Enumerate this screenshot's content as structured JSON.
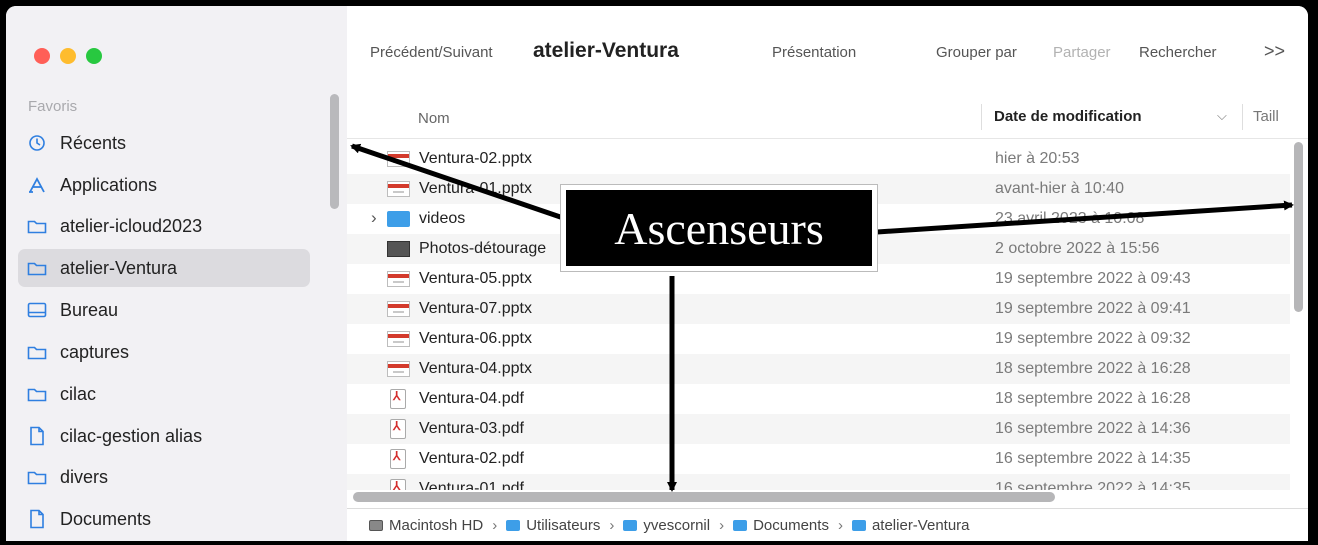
{
  "sidebar": {
    "section_title": "Favoris",
    "items": [
      {
        "label": "Récents",
        "icon": "clock-icon"
      },
      {
        "label": "Applications",
        "icon": "applications-icon"
      },
      {
        "label": "atelier-icloud2023",
        "icon": "folder-icon"
      },
      {
        "label": "atelier-Ventura",
        "icon": "folder-icon"
      },
      {
        "label": "Bureau",
        "icon": "desktop-icon"
      },
      {
        "label": "captures",
        "icon": "folder-icon"
      },
      {
        "label": "cilac",
        "icon": "folder-icon"
      },
      {
        "label": "cilac-gestion alias",
        "icon": "document-icon"
      },
      {
        "label": "divers",
        "icon": "folder-icon"
      },
      {
        "label": "Documents",
        "icon": "document-icon"
      }
    ]
  },
  "toolbar": {
    "nav_label": "Précédent/Suivant",
    "title": "atelier-Ventura",
    "view_label": "Présentation",
    "group_label": "Grouper par",
    "share_label": "Partager",
    "search_label": "Rechercher",
    "more_label": ">>"
  },
  "columns": {
    "name": "Nom",
    "date": "Date de modification",
    "size": "Taill"
  },
  "files": [
    {
      "name": "Ventura-02.pptx",
      "date": "hier à 20:53",
      "type": "pptx"
    },
    {
      "name": "Ventura-01.pptx",
      "date": "avant-hier à 10:40",
      "type": "pptx"
    },
    {
      "name": "videos",
      "date": "23 avril 2023 à 10:08",
      "type": "folder"
    },
    {
      "name": "Photos-détourage",
      "date": "2 octobre 2022 à 15:56",
      "type": "photo"
    },
    {
      "name": "Ventura-05.pptx",
      "date": "19 septembre 2022 à 09:43",
      "type": "pptx"
    },
    {
      "name": "Ventura-07.pptx",
      "date": "19 septembre 2022 à 09:41",
      "type": "pptx"
    },
    {
      "name": "Ventura-06.pptx",
      "date": "19 septembre 2022 à 09:32",
      "type": "pptx"
    },
    {
      "name": "Ventura-04.pptx",
      "date": "18 septembre 2022 à 16:28",
      "type": "pptx"
    },
    {
      "name": "Ventura-04.pdf",
      "date": "18 septembre 2022 à 16:28",
      "type": "pdf"
    },
    {
      "name": "Ventura-03.pdf",
      "date": "16 septembre 2022 à 14:36",
      "type": "pdf"
    },
    {
      "name": "Ventura-02.pdf",
      "date": "16 septembre 2022 à 14:35",
      "type": "pdf"
    },
    {
      "name": "Ventura-01.pdf",
      "date": "16 septembre 2022 à 14:35",
      "type": "pdf"
    }
  ],
  "path_bar": [
    {
      "label": "Macintosh HD",
      "icon": "hard-drive-icon"
    },
    {
      "label": "Utilisateurs",
      "icon": "folder-icon"
    },
    {
      "label": "yvescornil",
      "icon": "home-folder-icon"
    },
    {
      "label": "Documents",
      "icon": "folder-icon"
    },
    {
      "label": "atelier-Ventura",
      "icon": "folder-icon"
    }
  ],
  "callout": {
    "label": "Ascenseurs"
  },
  "colors": {
    "accent_folder": "#3d9ee8",
    "close": "#ff5f57",
    "minimize": "#febc2e",
    "zoom": "#28c840"
  }
}
